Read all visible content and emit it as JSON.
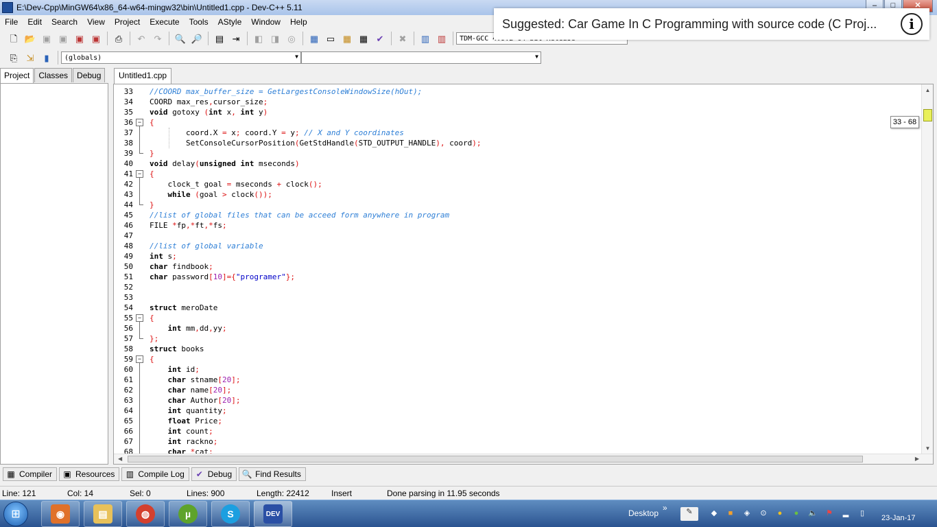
{
  "window": {
    "title": "E:\\Dev-Cpp\\MinGW64\\x86_64-w64-mingw32\\bin\\Untitled1.cpp - Dev-C++ 5.11",
    "min": "–",
    "max": "□",
    "close": "✕"
  },
  "menu": [
    "File",
    "Edit",
    "Search",
    "View",
    "Project",
    "Execute",
    "Tools",
    "AStyle",
    "Window",
    "Help"
  ],
  "toolbar": {
    "compiler_combo": "TDM-GCC 4.9.2 64-bit Release",
    "scope_combo": "(globals)",
    "member_combo": ""
  },
  "suggestion": {
    "text": "Suggested: Car Game In C Programming with source code (C Proj...",
    "info_icon": "i"
  },
  "left_panel": {
    "tabs": [
      "Project",
      "Classes",
      "Debug"
    ]
  },
  "editor": {
    "tab": "Untitled1.cpp",
    "tooltip": "33 - 68",
    "lines": [
      {
        "n": "33",
        "tokens": [
          [
            "cm",
            "//COORD max_buffer_size = GetLargestConsoleWindowSize(hOut);"
          ]
        ]
      },
      {
        "n": "34",
        "tokens": [
          [
            "idt",
            "COORD max_res"
          ],
          [
            "sym",
            ","
          ],
          [
            "idt",
            "cursor_size"
          ],
          [
            "sym",
            ";"
          ]
        ]
      },
      {
        "n": "35",
        "tokens": [
          [
            "kw",
            "void"
          ],
          [
            "idt",
            " gotoxy "
          ],
          [
            "sym",
            "("
          ],
          [
            "kw",
            "int"
          ],
          [
            "idt",
            " x"
          ],
          [
            "sym",
            ", "
          ],
          [
            "kw",
            "int"
          ],
          [
            "idt",
            " y"
          ],
          [
            "sym",
            ")"
          ]
        ]
      },
      {
        "n": "36",
        "tokens": [
          [
            "sym",
            "{"
          ]
        ]
      },
      {
        "n": "37",
        "tokens": [
          [
            "idt",
            "        coord.X "
          ],
          [
            "sym",
            "="
          ],
          [
            "idt",
            " x"
          ],
          [
            "sym",
            ";"
          ],
          [
            "idt",
            " coord.Y "
          ],
          [
            "sym",
            "="
          ],
          [
            "idt",
            " y"
          ],
          [
            "sym",
            ";"
          ],
          [
            "cm",
            " // X and Y coordinates"
          ]
        ]
      },
      {
        "n": "38",
        "tokens": [
          [
            "idt",
            "        SetConsoleCursorPosition"
          ],
          [
            "sym",
            "("
          ],
          [
            "idt",
            "GetStdHandle"
          ],
          [
            "sym",
            "("
          ],
          [
            "idt",
            "STD_OUTPUT_HANDLE"
          ],
          [
            "sym",
            "),"
          ],
          [
            "idt",
            " coord"
          ],
          [
            "sym",
            ");"
          ]
        ]
      },
      {
        "n": "39",
        "tokens": [
          [
            "sym",
            "}"
          ]
        ]
      },
      {
        "n": "40",
        "tokens": [
          [
            "kw",
            "void"
          ],
          [
            "idt",
            " delay"
          ],
          [
            "sym",
            "("
          ],
          [
            "kw",
            "unsigned int"
          ],
          [
            "idt",
            " mseconds"
          ],
          [
            "sym",
            ")"
          ]
        ]
      },
      {
        "n": "41",
        "tokens": [
          [
            "sym",
            "{"
          ]
        ]
      },
      {
        "n": "42",
        "tokens": [
          [
            "idt",
            "    clock_t goal "
          ],
          [
            "sym",
            "="
          ],
          [
            "idt",
            " mseconds "
          ],
          [
            "sym",
            "+"
          ],
          [
            "idt",
            " clock"
          ],
          [
            "sym",
            "();"
          ]
        ]
      },
      {
        "n": "43",
        "tokens": [
          [
            "kw",
            "    while"
          ],
          [
            "idt",
            " "
          ],
          [
            "sym",
            "("
          ],
          [
            "idt",
            "goal "
          ],
          [
            "sym",
            ">"
          ],
          [
            "idt",
            " clock"
          ],
          [
            "sym",
            "());"
          ]
        ]
      },
      {
        "n": "44",
        "tokens": [
          [
            "sym",
            "}"
          ]
        ]
      },
      {
        "n": "45",
        "tokens": [
          [
            "cm",
            "//list of global files that can be acceed form anywhere in program"
          ]
        ]
      },
      {
        "n": "46",
        "tokens": [
          [
            "idt",
            "FILE "
          ],
          [
            "sym",
            "*"
          ],
          [
            "idt",
            "fp"
          ],
          [
            "sym",
            ",*"
          ],
          [
            "idt",
            "ft"
          ],
          [
            "sym",
            ",*"
          ],
          [
            "idt",
            "fs"
          ],
          [
            "sym",
            ";"
          ]
        ]
      },
      {
        "n": "47",
        "tokens": []
      },
      {
        "n": "48",
        "tokens": [
          [
            "cm",
            "//list of global variable"
          ]
        ]
      },
      {
        "n": "49",
        "tokens": [
          [
            "kw",
            "int"
          ],
          [
            "idt",
            " s"
          ],
          [
            "sym",
            ";"
          ]
        ]
      },
      {
        "n": "50",
        "tokens": [
          [
            "kw",
            "char"
          ],
          [
            "idt",
            " findbook"
          ],
          [
            "sym",
            ";"
          ]
        ]
      },
      {
        "n": "51",
        "tokens": [
          [
            "kw",
            "char"
          ],
          [
            "idt",
            " password"
          ],
          [
            "sym",
            "["
          ],
          [
            "num",
            "10"
          ],
          [
            "sym",
            "]={"
          ],
          [
            "str",
            "\"programer\""
          ],
          [
            "sym",
            "};"
          ]
        ]
      },
      {
        "n": "52",
        "tokens": []
      },
      {
        "n": "53",
        "tokens": []
      },
      {
        "n": "54",
        "tokens": [
          [
            "kw",
            "struct"
          ],
          [
            "idt",
            " meroDate"
          ]
        ]
      },
      {
        "n": "55",
        "tokens": [
          [
            "sym",
            "{"
          ]
        ]
      },
      {
        "n": "56",
        "tokens": [
          [
            "kw",
            "    int"
          ],
          [
            "idt",
            " mm"
          ],
          [
            "sym",
            ","
          ],
          [
            "idt",
            "dd"
          ],
          [
            "sym",
            ","
          ],
          [
            "idt",
            "yy"
          ],
          [
            "sym",
            ";"
          ]
        ]
      },
      {
        "n": "57",
        "tokens": [
          [
            "sym",
            "};"
          ]
        ]
      },
      {
        "n": "58",
        "tokens": [
          [
            "kw",
            "struct"
          ],
          [
            "idt",
            " books"
          ]
        ]
      },
      {
        "n": "59",
        "tokens": [
          [
            "sym",
            "{"
          ]
        ]
      },
      {
        "n": "60",
        "tokens": [
          [
            "kw",
            "    int"
          ],
          [
            "idt",
            " id"
          ],
          [
            "sym",
            ";"
          ]
        ]
      },
      {
        "n": "61",
        "tokens": [
          [
            "kw",
            "    char"
          ],
          [
            "idt",
            " stname"
          ],
          [
            "sym",
            "["
          ],
          [
            "num",
            "20"
          ],
          [
            "sym",
            "];"
          ]
        ]
      },
      {
        "n": "62",
        "tokens": [
          [
            "kw",
            "    char"
          ],
          [
            "idt",
            " name"
          ],
          [
            "sym",
            "["
          ],
          [
            "num",
            "20"
          ],
          [
            "sym",
            "];"
          ]
        ]
      },
      {
        "n": "63",
        "tokens": [
          [
            "kw",
            "    char"
          ],
          [
            "idt",
            " Author"
          ],
          [
            "sym",
            "["
          ],
          [
            "num",
            "20"
          ],
          [
            "sym",
            "];"
          ]
        ]
      },
      {
        "n": "64",
        "tokens": [
          [
            "kw",
            "    int"
          ],
          [
            "idt",
            " quantity"
          ],
          [
            "sym",
            ";"
          ]
        ]
      },
      {
        "n": "65",
        "tokens": [
          [
            "kw",
            "    float"
          ],
          [
            "idt",
            " Price"
          ],
          [
            "sym",
            ";"
          ]
        ]
      },
      {
        "n": "66",
        "tokens": [
          [
            "kw",
            "    int"
          ],
          [
            "idt",
            " count"
          ],
          [
            "sym",
            ";"
          ]
        ]
      },
      {
        "n": "67",
        "tokens": [
          [
            "kw",
            "    int"
          ],
          [
            "idt",
            " rackno"
          ],
          [
            "sym",
            ";"
          ]
        ]
      },
      {
        "n": "68",
        "tokens": [
          [
            "kw",
            "    char"
          ],
          [
            "idt",
            " "
          ],
          [
            "sym",
            "*"
          ],
          [
            "idt",
            "cat"
          ],
          [
            "sym",
            ";"
          ]
        ]
      }
    ]
  },
  "bottom_tabs": [
    {
      "label": "Compiler",
      "icon": "grid-icon"
    },
    {
      "label": "Resources",
      "icon": "resources-icon"
    },
    {
      "label": "Compile Log",
      "icon": "chart-icon"
    },
    {
      "label": "Debug",
      "icon": "check-icon"
    },
    {
      "label": "Find Results",
      "icon": "find-icon"
    }
  ],
  "status": {
    "line": "Line:  121",
    "col": "Col:   14",
    "sel": "Sel:   0",
    "lines": "Lines:   900",
    "length": "Length: 22412",
    "mode": "Insert",
    "message": "Done parsing in 11.95 seconds"
  },
  "taskbar": {
    "desktop_label": "Desktop",
    "chevron": "»",
    "date": "23-Jan-17",
    "apps": [
      {
        "name": "start-orb",
        "glyph": "⊞",
        "color": "#2a74c9"
      },
      {
        "name": "app-orange",
        "glyph": "◉",
        "color": "#e0712a"
      },
      {
        "name": "explorer",
        "glyph": "▤",
        "color": "#e8c15a"
      },
      {
        "name": "chrome",
        "glyph": "◍",
        "color": "#d4402e"
      },
      {
        "name": "utorrent",
        "glyph": "µ",
        "color": "#5ea32b"
      },
      {
        "name": "skype",
        "glyph": "S",
        "color": "#1c9fe0"
      },
      {
        "name": "devcpp",
        "glyph": "DEV",
        "color": "#2a4fa5"
      }
    ]
  }
}
